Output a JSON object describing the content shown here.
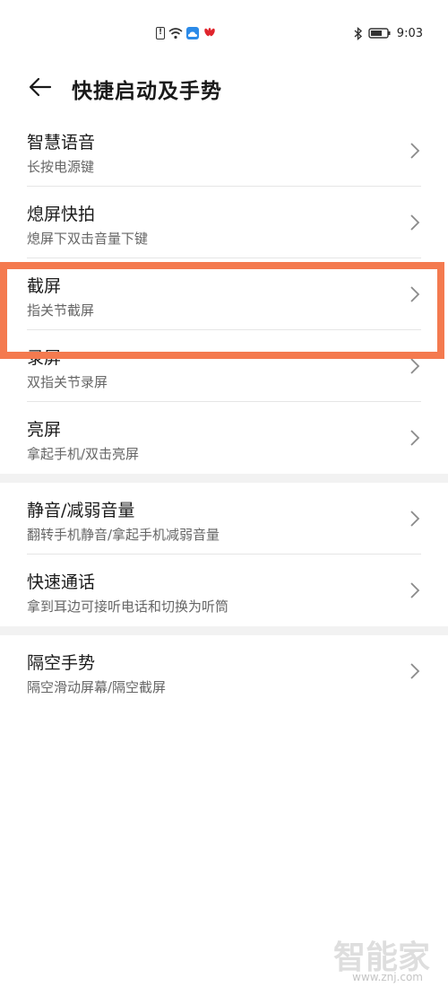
{
  "status_bar": {
    "time": "9:03",
    "icons": [
      "sim-alert-icon",
      "wifi-icon",
      "cloud-icon",
      "huawei-logo-icon",
      "bluetooth-icon",
      "battery-icon"
    ],
    "cloud_color": "#2b8ae8",
    "huawei_color": "#e0242c"
  },
  "header": {
    "title": "快捷启动及手势",
    "back_icon": "arrow-left-icon"
  },
  "groups": [
    {
      "items": [
        {
          "title": "智慧语音",
          "subtitle": "长按电源键"
        },
        {
          "title": "熄屏快拍",
          "subtitle": "熄屏下双击音量下键"
        },
        {
          "title": "截屏",
          "subtitle": "指关节截屏"
        },
        {
          "title": "录屏",
          "subtitle": "双指关节录屏"
        },
        {
          "title": "亮屏",
          "subtitle": "拿起手机/双击亮屏"
        }
      ]
    },
    {
      "items": [
        {
          "title": "静音/减弱音量",
          "subtitle": "翻转手机静音/拿起手机减弱音量"
        },
        {
          "title": "快速通话",
          "subtitle": "拿到耳边可接听电话和切换为听筒"
        }
      ]
    },
    {
      "items": [
        {
          "title": "隔空手势",
          "subtitle": "隔空滑动屏幕/隔空截屏"
        }
      ]
    }
  ],
  "highlight": {
    "target": "截屏",
    "color": "#f47a4f"
  },
  "watermark": {
    "main": "智能家",
    "sub": "www.znj.com"
  }
}
